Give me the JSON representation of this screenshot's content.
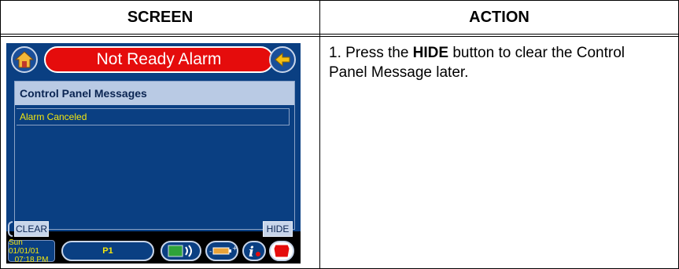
{
  "table": {
    "header_screen": "SCREEN",
    "header_action": "ACTION",
    "action_step_prefix": "1. Press the ",
    "action_step_bold": "HIDE",
    "action_step_suffix": " button to clear the Control Panel Message later."
  },
  "device": {
    "title": "Not Ready Alarm",
    "panel_header": "Control Panel Messages",
    "messages": [
      "Alarm Canceled"
    ],
    "clear_label": "CLEAR",
    "hide_label": "HIDE",
    "date": "Sun 01/01/01",
    "time": "07:18 PM",
    "partition": "P1",
    "colors": {
      "panel_blue": "#0a3f82",
      "alarm_red": "#e50c0c",
      "message_yellow": "#f3e60e",
      "header_gray_blue": "#b9cae4"
    },
    "icons": [
      "home-icon",
      "back-arrow-icon",
      "speaker-icon",
      "battery-icon",
      "info-icon",
      "emergency-icon"
    ]
  }
}
